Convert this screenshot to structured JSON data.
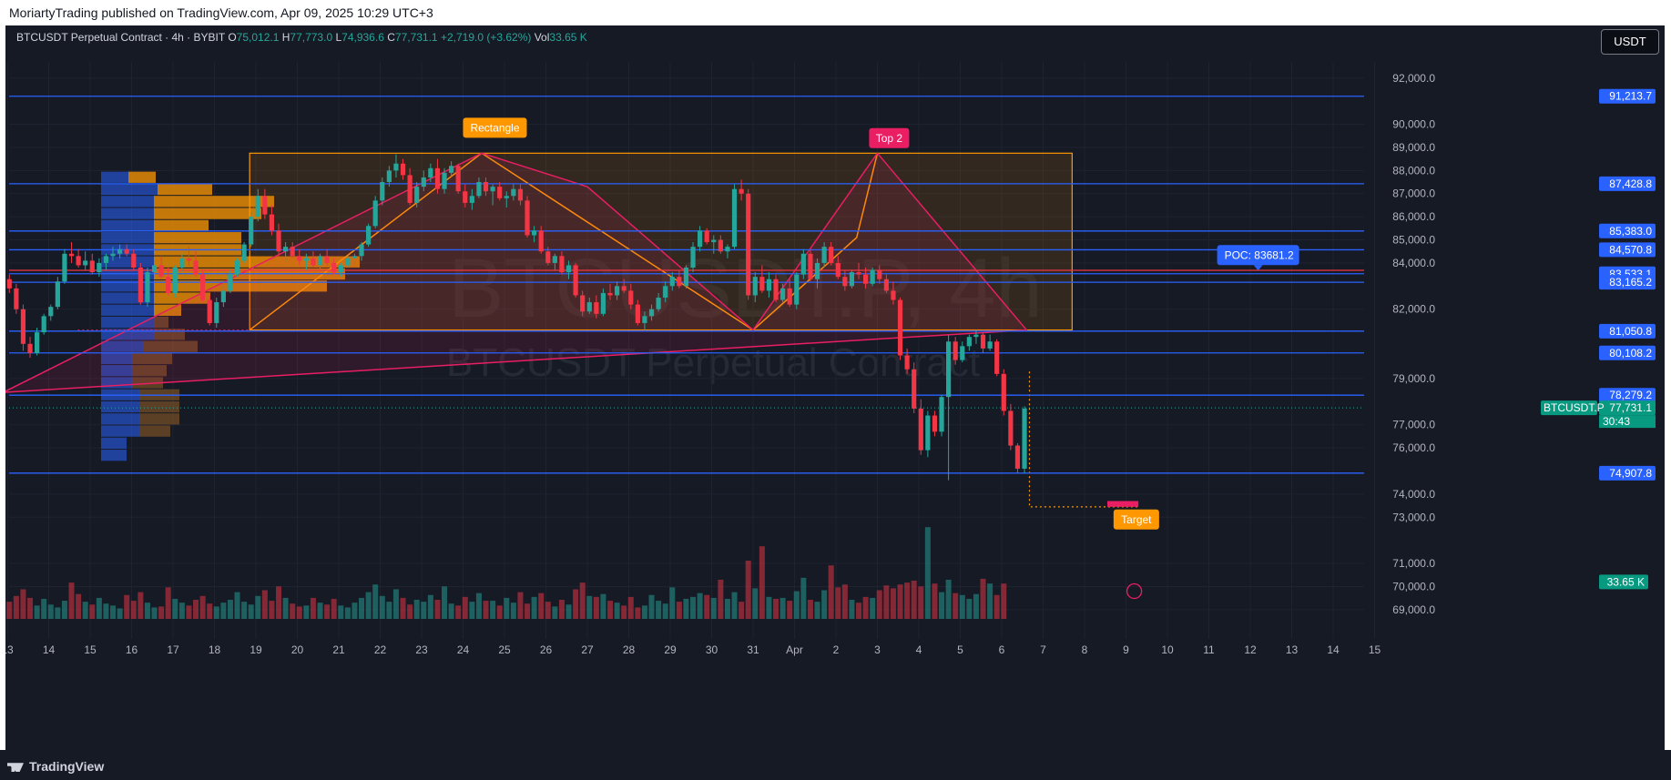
{
  "publish_line": "MoriartyTrading published on TradingView.com, Apr 09, 2025 10:29 UTC+3",
  "header": {
    "symbol": "BTCUSDT Perpetual Contract · 4h · BYBIT",
    "o_label": "O",
    "o_value": "75,012.1",
    "h_label": "H",
    "h_value": "77,773.0",
    "l_label": "L",
    "l_value": "74,936.6",
    "c_label": "C",
    "c_value": "77,731.1",
    "change": "+2,719.0 (+3.62%)",
    "vol_label": "Vol",
    "vol_value": "33.65 K"
  },
  "currency_button": "USDT",
  "brand": "TradingView",
  "watermark": {
    "big": "BTCUSDT.P, 4h",
    "small": "BTCUSDT Perpetual Contract"
  },
  "colors": {
    "background": "#161a25",
    "up": "#26a69a",
    "down": "#f23645",
    "level": "#2962ff",
    "pattern": "#ff9800",
    "trend": "#e91e63"
  },
  "chart_data": {
    "type": "candlestick",
    "symbol": "BTCUSDT.P",
    "timeframe": "4h",
    "ylim": [
      68600,
      92700
    ],
    "y_ticks": [
      "92,000.0",
      "90,000.0",
      "89,000.0",
      "88,000.0",
      "87,000.0",
      "86,000.0",
      "85,000.0",
      "84,000.0",
      "82,000.0",
      "79,000.0",
      "77,000.0",
      "76,000.0",
      "74,000.0",
      "73,000.0",
      "71,000.0",
      "70,000.0",
      "69,000.0"
    ],
    "y_tick_values": [
      92000,
      90000,
      89000,
      88000,
      87000,
      86000,
      85000,
      84000,
      82000,
      79000,
      77000,
      76000,
      74000,
      73000,
      71000,
      70000,
      69000
    ],
    "x_ticks": [
      "13",
      "14",
      "15",
      "16",
      "17",
      "18",
      "19",
      "20",
      "21",
      "22",
      "23",
      "24",
      "25",
      "26",
      "27",
      "28",
      "29",
      "30",
      "31",
      "Apr",
      "2",
      "3",
      "4",
      "5",
      "6",
      "7",
      "8",
      "9",
      "10",
      "11",
      "12",
      "13",
      "14",
      "15"
    ],
    "horizontal_levels": [
      {
        "price": 91213.7,
        "label": "91,213.7"
      },
      {
        "price": 87428.8,
        "label": "87,428.8"
      },
      {
        "price": 85383.0,
        "label": "85,383.0"
      },
      {
        "price": 84570.8,
        "label": "84,570.8"
      },
      {
        "price": 83533.1,
        "label": "83,533.1"
      },
      {
        "price": 83165.2,
        "label": "83,165.2"
      },
      {
        "price": 81050.8,
        "label": "81,050.8"
      },
      {
        "price": 80108.2,
        "label": "80,108.2"
      },
      {
        "price": 78279.2,
        "label": "78,279.2"
      },
      {
        "price": 74907.8,
        "label": "74,907.8"
      }
    ],
    "last_price": {
      "price": 77731.1,
      "label": "77,731.1",
      "symbol_tag": "BTCUSDT.P",
      "countdown": "30:43"
    },
    "volume_tag": "33.65 K",
    "poc": {
      "price": 83681.2,
      "label": "POC: 83681.2"
    },
    "annotations": [
      {
        "text": "Rectangle",
        "color": "#ff9800"
      },
      {
        "text": "Top 2",
        "color": "#e91e63"
      },
      {
        "text": "Target",
        "color": "#ff9800"
      }
    ],
    "rectangle": {
      "top": 88750,
      "bottom": 81100,
      "start_day": 18.5,
      "end_day": 6.7
    },
    "target_zone": {
      "top": 73700,
      "bottom": 73450
    },
    "candles": [
      [
        83300,
        83500,
        82700,
        82900
      ],
      [
        82900,
        83100,
        81800,
        82000
      ],
      [
        82000,
        82200,
        80200,
        80500
      ],
      [
        80500,
        80800,
        79900,
        80100
      ],
      [
        80100,
        81200,
        80000,
        81000
      ],
      [
        81000,
        81800,
        80900,
        81700
      ],
      [
        81700,
        82200,
        81500,
        82100
      ],
      [
        82100,
        83400,
        82000,
        83200
      ],
      [
        83200,
        84600,
        83100,
        84400
      ],
      [
        84400,
        84900,
        84000,
        84300
      ],
      [
        84300,
        84600,
        83800,
        83900
      ],
      [
        83900,
        84500,
        83700,
        84100
      ],
      [
        84100,
        84400,
        83500,
        83600
      ],
      [
        83600,
        84200,
        83400,
        84000
      ],
      [
        84000,
        84400,
        83700,
        84300
      ],
      [
        84300,
        84700,
        84100,
        84400
      ],
      [
        84400,
        84800,
        84200,
        84600
      ],
      [
        84600,
        84800,
        84300,
        84400
      ],
      [
        84400,
        84600,
        83700,
        83800
      ],
      [
        83800,
        84000,
        82200,
        82300
      ],
      [
        82300,
        83800,
        82100,
        83600
      ],
      [
        83600,
        84100,
        83400,
        83900
      ],
      [
        83900,
        84300,
        83300,
        83400
      ],
      [
        83400,
        83800,
        82600,
        82700
      ],
      [
        82700,
        83900,
        82500,
        83800
      ],
      [
        83800,
        84400,
        83600,
        84200
      ],
      [
        84200,
        84700,
        83900,
        84100
      ],
      [
        84100,
        84500,
        83400,
        83500
      ],
      [
        83500,
        83700,
        82300,
        82400
      ],
      [
        82400,
        82600,
        81300,
        81400
      ],
      [
        81400,
        82500,
        81200,
        82300
      ],
      [
        82300,
        83000,
        82100,
        82800
      ],
      [
        82800,
        83700,
        82700,
        83500
      ],
      [
        83500,
        84200,
        83400,
        84100
      ],
      [
        84100,
        84900,
        84000,
        84800
      ],
      [
        84800,
        86200,
        84700,
        86000
      ],
      [
        86000,
        87200,
        85800,
        86900
      ],
      [
        86900,
        87200,
        85900,
        86100
      ],
      [
        86100,
        86500,
        85200,
        85400
      ],
      [
        85400,
        85700,
        84300,
        84500
      ],
      [
        84500,
        84900,
        84000,
        84700
      ],
      [
        84700,
        84900,
        84200,
        84300
      ],
      [
        84300,
        84600,
        83900,
        84100
      ],
      [
        84100,
        84400,
        83700,
        84200
      ],
      [
        84200,
        84500,
        83800,
        83900
      ],
      [
        83900,
        84400,
        83700,
        84300
      ],
      [
        84300,
        84600,
        83900,
        84000
      ],
      [
        84000,
        84200,
        83500,
        83600
      ],
      [
        83600,
        84000,
        83400,
        83900
      ],
      [
        83900,
        84300,
        83800,
        84200
      ],
      [
        84200,
        84400,
        83900,
        84300
      ],
      [
        84300,
        84900,
        84100,
        84800
      ],
      [
        84800,
        85700,
        84700,
        85600
      ],
      [
        85600,
        86900,
        85500,
        86700
      ],
      [
        86700,
        87700,
        86500,
        87500
      ],
      [
        87500,
        88200,
        87300,
        88000
      ],
      [
        88000,
        88700,
        87700,
        88300
      ],
      [
        88300,
        88500,
        87600,
        87800
      ],
      [
        87800,
        88100,
        86500,
        86600
      ],
      [
        86600,
        87500,
        86400,
        87300
      ],
      [
        87300,
        88000,
        87100,
        87700
      ],
      [
        87700,
        88300,
        87500,
        88100
      ],
      [
        88100,
        88500,
        87000,
        87200
      ],
      [
        87200,
        88100,
        87000,
        87900
      ],
      [
        87900,
        88400,
        87700,
        88200
      ],
      [
        88200,
        88300,
        87000,
        87100
      ],
      [
        87100,
        87400,
        86400,
        86600
      ],
      [
        86600,
        87200,
        86300,
        86900
      ],
      [
        86900,
        87700,
        86800,
        87500
      ],
      [
        87500,
        87700,
        86900,
        87100
      ],
      [
        87100,
        87400,
        86500,
        87300
      ],
      [
        87300,
        87500,
        86700,
        86800
      ],
      [
        86800,
        87100,
        86400,
        86900
      ],
      [
        86900,
        87400,
        86700,
        87200
      ],
      [
        87200,
        87400,
        86500,
        86700
      ],
      [
        86700,
        86900,
        85100,
        85200
      ],
      [
        85200,
        85600,
        84900,
        85400
      ],
      [
        85400,
        85600,
        84400,
        84500
      ],
      [
        84500,
        84700,
        83900,
        84000
      ],
      [
        84000,
        84400,
        83700,
        84300
      ],
      [
        84300,
        84500,
        83500,
        83600
      ],
      [
        83600,
        84100,
        83300,
        83900
      ],
      [
        83900,
        84000,
        82500,
        82600
      ],
      [
        82600,
        82800,
        81700,
        81900
      ],
      [
        81900,
        82500,
        81800,
        82300
      ],
      [
        82300,
        82600,
        81600,
        81800
      ],
      [
        81800,
        82900,
        81700,
        82700
      ],
      [
        82700,
        83100,
        82400,
        82600
      ],
      [
        82600,
        83200,
        82400,
        83000
      ],
      [
        83000,
        83300,
        82700,
        82800
      ],
      [
        82800,
        83100,
        82000,
        82200
      ],
      [
        82200,
        82400,
        81300,
        81400
      ],
      [
        81400,
        81900,
        81100,
        81700
      ],
      [
        81700,
        82200,
        81500,
        82000
      ],
      [
        82000,
        82700,
        81900,
        82500
      ],
      [
        82500,
        83200,
        82300,
        83000
      ],
      [
        83000,
        83600,
        82800,
        83400
      ],
      [
        83400,
        83700,
        82900,
        83000
      ],
      [
        83000,
        83900,
        82900,
        83800
      ],
      [
        83800,
        84900,
        83600,
        84700
      ],
      [
        84700,
        85600,
        84500,
        85400
      ],
      [
        85400,
        85500,
        84800,
        84900
      ],
      [
        84900,
        85200,
        84400,
        85000
      ],
      [
        85000,
        85200,
        84400,
        84500
      ],
      [
        84500,
        84800,
        84200,
        84700
      ],
      [
        84700,
        87400,
        84600,
        87200
      ],
      [
        87200,
        87600,
        86700,
        87000
      ],
      [
        87000,
        87200,
        82400,
        82600
      ],
      [
        82600,
        83600,
        82300,
        83400
      ],
      [
        83400,
        83900,
        82700,
        82800
      ],
      [
        82800,
        83600,
        82500,
        83300
      ],
      [
        83300,
        83500,
        82300,
        82400
      ],
      [
        82400,
        83100,
        82300,
        82900
      ],
      [
        82900,
        83300,
        82100,
        82200
      ],
      [
        82200,
        83600,
        82000,
        83500
      ],
      [
        83500,
        84600,
        83300,
        84400
      ],
      [
        84400,
        84600,
        83200,
        83300
      ],
      [
        83300,
        84200,
        82900,
        84000
      ],
      [
        84000,
        84900,
        83800,
        84700
      ],
      [
        84700,
        84900,
        83900,
        84000
      ],
      [
        84000,
        84300,
        83300,
        83400
      ],
      [
        83400,
        83700,
        82800,
        83000
      ],
      [
        83000,
        83700,
        82900,
        83600
      ],
      [
        83600,
        84000,
        83300,
        83500
      ],
      [
        83500,
        83800,
        82900,
        83100
      ],
      [
        83100,
        83800,
        83000,
        83700
      ],
      [
        83700,
        83900,
        83100,
        83300
      ],
      [
        83300,
        83500,
        82700,
        82800
      ],
      [
        82800,
        83200,
        82200,
        82400
      ],
      [
        82400,
        82500,
        79800,
        80000
      ],
      [
        80000,
        80300,
        79200,
        79400
      ],
      [
        79400,
        79700,
        77500,
        77700
      ],
      [
        77700,
        78100,
        75700,
        75900
      ],
      [
        75900,
        77600,
        75600,
        77400
      ],
      [
        77400,
        77600,
        76500,
        76700
      ],
      [
        76700,
        78300,
        76500,
        78200
      ],
      [
        78200,
        80900,
        74600,
        80600
      ],
      [
        80600,
        80800,
        79600,
        79800
      ],
      [
        79800,
        80600,
        79700,
        80400
      ],
      [
        80400,
        80900,
        80200,
        80800
      ],
      [
        80800,
        81100,
        80500,
        80900
      ],
      [
        80900,
        81000,
        80100,
        80300
      ],
      [
        80300,
        80900,
        80200,
        80600
      ],
      [
        80600,
        80700,
        79100,
        79200
      ],
      [
        79200,
        79400,
        77400,
        77600
      ],
      [
        77600,
        77900,
        75900,
        76100
      ],
      [
        76100,
        76200,
        74900,
        75100
      ],
      [
        75100,
        77800,
        74900,
        77700
      ]
    ],
    "volumes": [
      18,
      24,
      31,
      22,
      14,
      21,
      15,
      12,
      19,
      38,
      26,
      18,
      15,
      22,
      16,
      14,
      11,
      25,
      19,
      28,
      17,
      12,
      13,
      33,
      21,
      17,
      14,
      20,
      24,
      16,
      13,
      17,
      20,
      28,
      18,
      15,
      24,
      30,
      19,
      34,
      22,
      16,
      13,
      14,
      22,
      17,
      15,
      21,
      14,
      12,
      17,
      22,
      28,
      36,
      24,
      18,
      31,
      22,
      15,
      20,
      18,
      25,
      20,
      34,
      16,
      14,
      23,
      18,
      27,
      19,
      19,
      14,
      22,
      17,
      28,
      16,
      23,
      27,
      18,
      13,
      20,
      15,
      31,
      38,
      24,
      23,
      26,
      19,
      17,
      14,
      23,
      12,
      14,
      25,
      19,
      16,
      33,
      18,
      21,
      23,
      27,
      25,
      22,
      41,
      21,
      28,
      18,
      61,
      32,
      76,
      23,
      21,
      22,
      19,
      29,
      43,
      20,
      18,
      30,
      56,
      33,
      36,
      20,
      17,
      23,
      22,
      30,
      35,
      32,
      36,
      38,
      40,
      34,
      96,
      37,
      28,
      41,
      27,
      25,
      21,
      26,
      42,
      37,
      25,
      37
    ]
  }
}
